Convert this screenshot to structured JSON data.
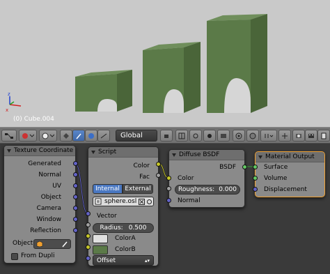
{
  "viewport": {
    "object_label": "(0) Cube.004",
    "colors": {
      "background": "#c9c9c9",
      "cube_front": "#5b7a48",
      "cube_top": "#6f8e5b",
      "cube_side": "#4a6539",
      "sphere": "#d6d6d6"
    }
  },
  "header": {
    "icons": [
      "node-tree-icon",
      "material-sphere-icon",
      "object-icon",
      "brush-icon",
      "world-icon",
      "pin-icon",
      "backdrop-icon",
      "layout-icon"
    ],
    "selector_value": "Global"
  },
  "nodes": {
    "texcoord": {
      "title": "Texture Coordinate",
      "outputs": [
        "Generated",
        "Normal",
        "UV",
        "Object",
        "Camera",
        "Window",
        "Reflection"
      ],
      "object_label": "Object:",
      "from_dupli_label": "From Dupli"
    },
    "script": {
      "title": "Script",
      "outputs": [
        "Color",
        "Fac"
      ],
      "mode_internal": "Internal",
      "mode_external": "External",
      "script_name": "sphere.osl",
      "vector_label": "Vector",
      "radius_label": "Radius:",
      "radius_value": "0.500",
      "color_a_label": "ColorA",
      "color_b_label": "ColorB",
      "offset_value": "Offset",
      "color_a": "#e0e0e0",
      "color_b": "#5b7a48"
    },
    "diffuse": {
      "title": "Diffuse BSDF",
      "output": "BSDF",
      "color_label": "Color",
      "roughness_label": "Roughness:",
      "roughness_value": "0.000",
      "normal_label": "Normal"
    },
    "output": {
      "title": "Material Output",
      "inputs": [
        "Surface",
        "Volume",
        "Displacement"
      ],
      "accent": "#f0a030"
    }
  }
}
